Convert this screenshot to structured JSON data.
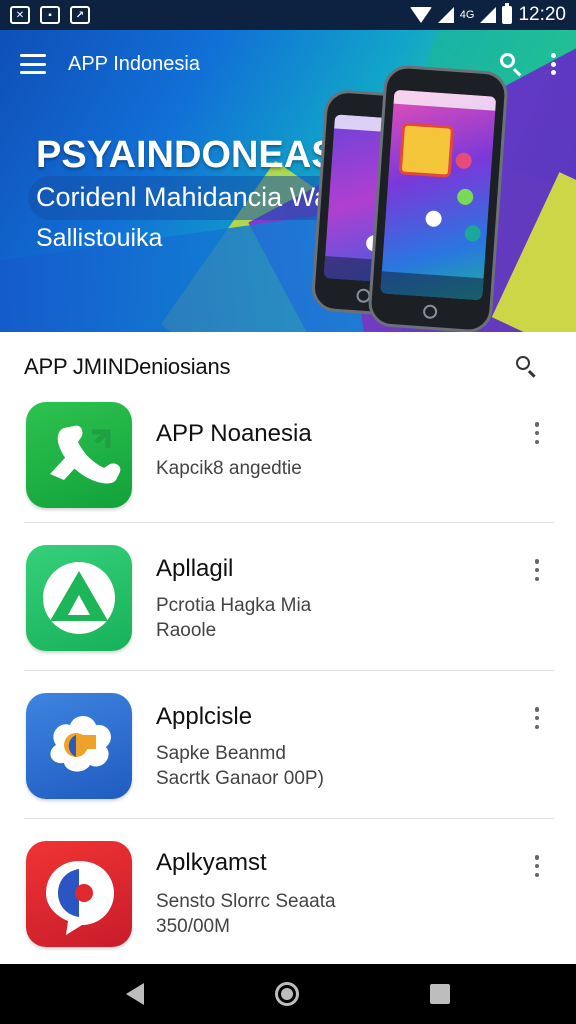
{
  "status_bar": {
    "left_icons": [
      "photo-icon",
      "image-icon",
      "notification-icon"
    ],
    "signal_label": "4G",
    "time": "12:20"
  },
  "toolbar": {
    "title": "APP Indonesia"
  },
  "hero": {
    "title": "PSYAINDONEASIA",
    "subtitle_line1": "Coridenl Mahidancia Waby",
    "subtitle_line2": "Sallistouika"
  },
  "section": {
    "title": "APP JMINDeniosians"
  },
  "apps": [
    {
      "name": "APP Noanesia",
      "desc_line1": "Kapcik8 angedtie",
      "desc_line2": "",
      "icon": "phone-call-icon",
      "color": "#1fb245"
    },
    {
      "name": "Apllagil",
      "desc_line1": "Pcrotia Hagka Mia",
      "desc_line2": "Raoole",
      "icon": "drive-triangle-icon",
      "color": "#22c066"
    },
    {
      "name": "Applcisle",
      "desc_line1": "Sapke Beanmd",
      "desc_line2": "Sacrtk Ganaor 00P)",
      "icon": "cloud-chat-icon",
      "color": "#2f6fd2"
    },
    {
      "name": "Aplkyamst",
      "desc_line1": "Sensto Slorrc Seaata",
      "desc_line2": "350/00M",
      "icon": "chat-bubble-icon",
      "color": "#e0282f"
    }
  ],
  "colors": {
    "status_bar_bg": "#0d2240",
    "nav_bar_bg": "#000000"
  }
}
